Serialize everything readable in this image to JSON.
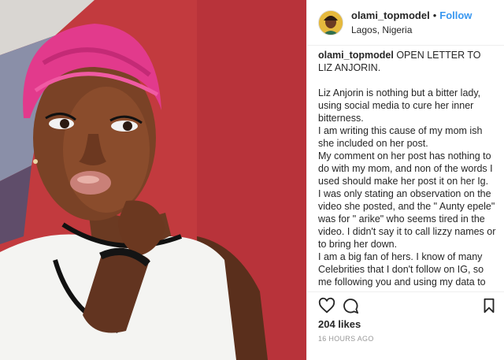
{
  "post": {
    "username": "olami_topmodel",
    "separator": "•",
    "follow_label": "Follow",
    "location": "Lagos, Nigeria",
    "caption_user": "olami_topmodel",
    "caption_title": "OPEN LETTER TO LIZ ANJORIN.",
    "caption_body": "Liz Anjorin is nothing but a bitter lady, using social media to cure her inner bitterness.\nI am writing this cause of my mom ish she included on her post.\nMy comment on her post has nothing to do with my mom, and non of the words I used should make her post it on her Ig.\nI was only stating an observation on the video she posted, and the \" Aunty epele\" was for \" arike\" who seems tired in the video. I didn't say it to call lizzy names or to bring her down.\nI am a big fan of hers. I know of many Celebrities that I don't follow on IG, so me following you and using my data to watch your videos and to comment on your",
    "likes": "204 likes",
    "timestamp": "16 HOURS AGO"
  },
  "icons": {
    "like": "heart-icon",
    "comment": "comment-icon",
    "save": "bookmark-icon"
  },
  "colors": {
    "link": "#3897f0",
    "backdrop": "#c8383d",
    "turban": "#e8388a"
  }
}
